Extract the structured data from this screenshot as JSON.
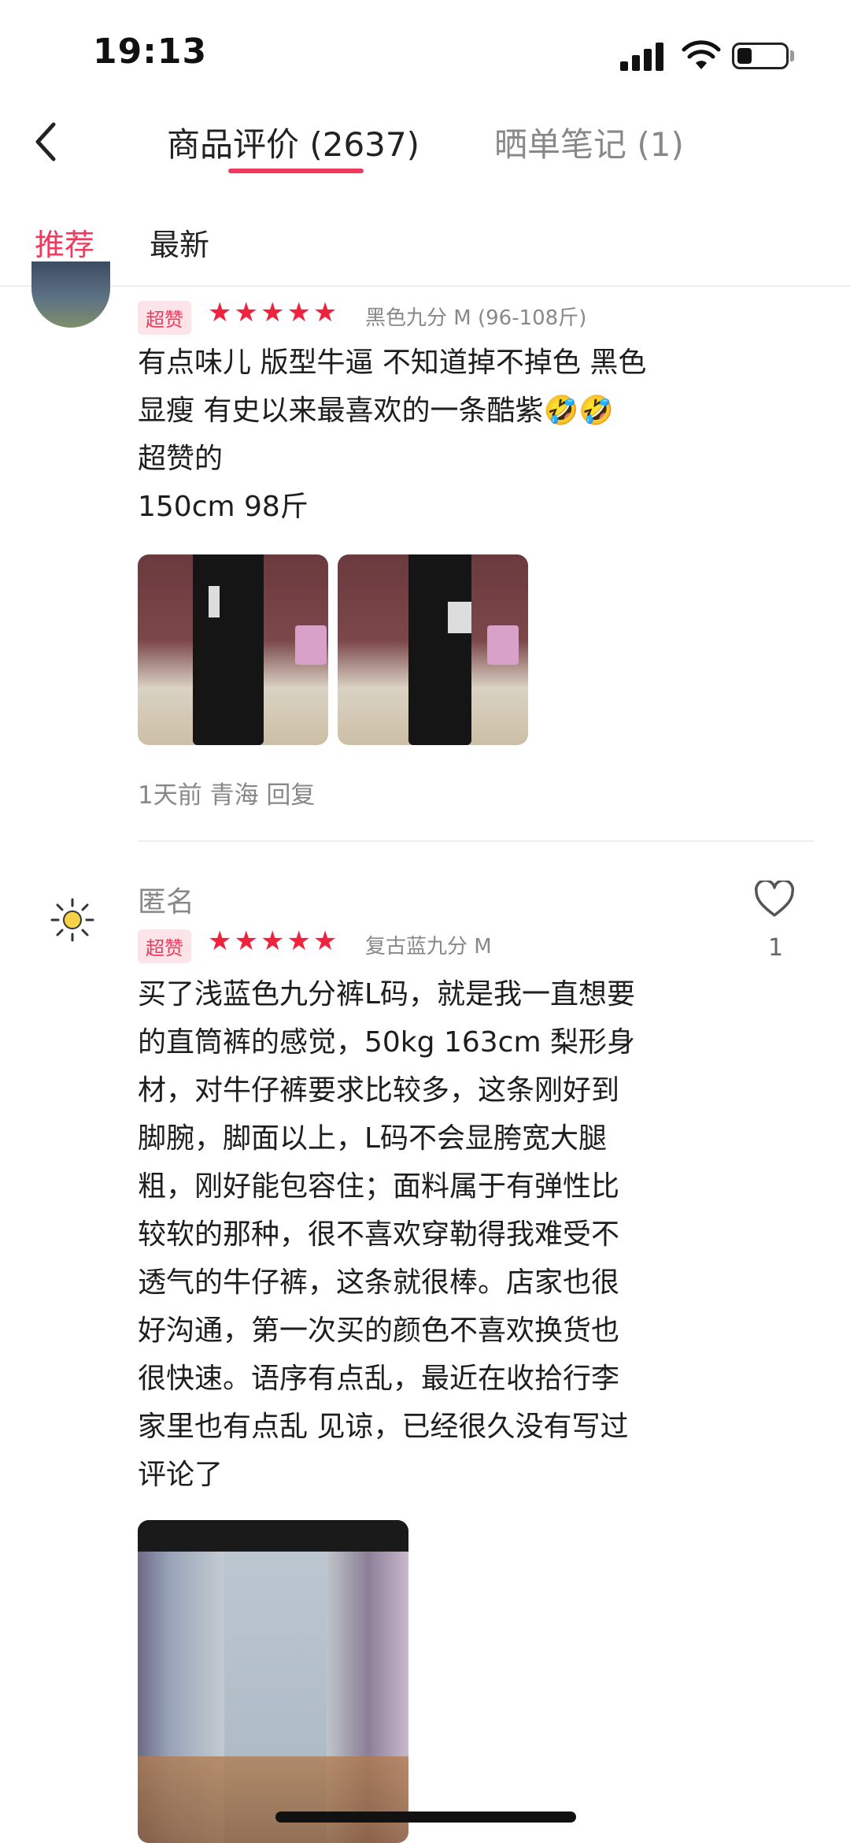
{
  "status_bar": {
    "time": "19:13"
  },
  "nav": {
    "tabs": [
      {
        "label": "商品评价 (2637)",
        "active": true
      },
      {
        "label": "晒单笔记 (1)",
        "active": false
      }
    ]
  },
  "filters": [
    {
      "label": "推荐",
      "active": true
    },
    {
      "label": "最新",
      "active": false
    }
  ],
  "colors": {
    "accent": "#ef3a5d",
    "star": "#f0233f"
  },
  "reviews": [
    {
      "badge": "超赞",
      "rating": 5,
      "spec": "黑色九分 M (96-108斤)",
      "lines": [
        "有点味儿 版型牛逼 不知道掉不掉色 黑色",
        "显瘦 有史以来最喜欢的一条酷紫🤣🤣",
        "超赞的",
        "150cm 98斤"
      ],
      "photo_count": 2,
      "meta": "1天前 青海 回复"
    },
    {
      "username": "匿名",
      "badge": "超赞",
      "rating": 5,
      "spec": "复古蓝九分 M",
      "likes": "1",
      "lines": [
        "买了浅蓝色九分裤L码，就是我一直想要",
        "的直筒裤的感觉，50kg 163cm 梨形身",
        "材，对牛仔裤要求比较多，这条刚好到",
        "脚腕，脚面以上，L码不会显胯宽大腿",
        "粗，刚好能包容住；面料属于有弹性比",
        "较软的那种，很不喜欢穿勒得我难受不",
        "透气的牛仔裤，这条就很棒。店家也很",
        "好沟通，第一次买的颜色不喜欢换货也",
        "很快速。语序有点乱，最近在收拾行李",
        "家里也有点乱 见谅，已经很久没有写过",
        "评论了"
      ],
      "photo_count": 1
    }
  ],
  "icons": [
    "back-arrow-icon",
    "heart-icon",
    "signal-icon",
    "wifi-icon",
    "battery-icon"
  ]
}
